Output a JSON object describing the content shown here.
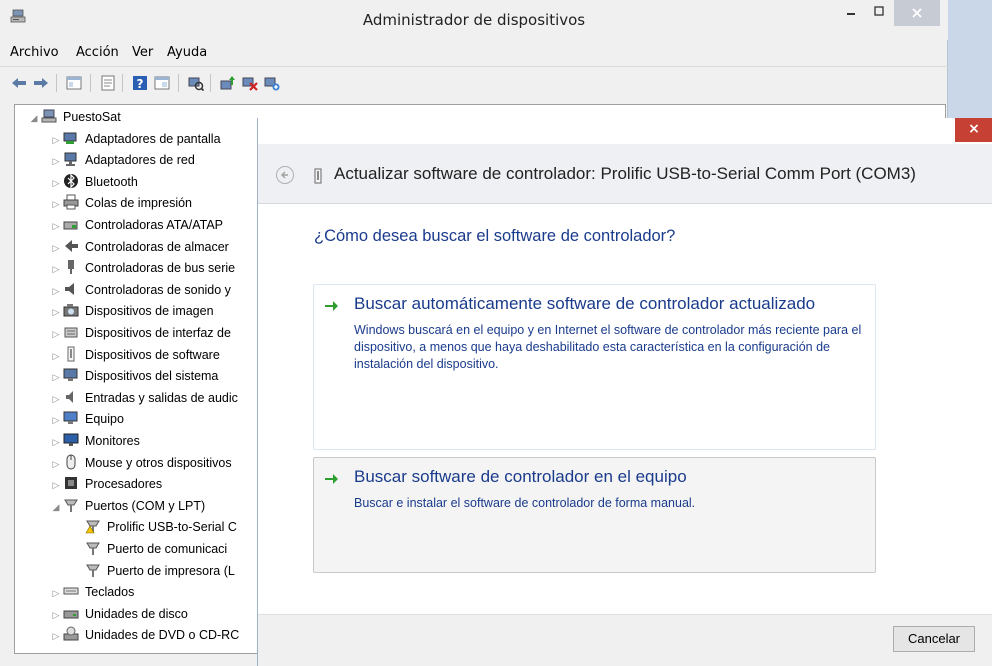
{
  "window": {
    "title": "Administrador de dispositivos"
  },
  "menu": [
    "Archivo",
    "Acción",
    "Ver",
    "Ayuda"
  ],
  "tree": {
    "root": "PuestoSat",
    "items": [
      {
        "label": "Adaptadores de pantalla",
        "icon": "display-adapter-icon"
      },
      {
        "label": "Adaptadores de red",
        "icon": "network-adapter-icon"
      },
      {
        "label": "Bluetooth",
        "icon": "bluetooth-icon"
      },
      {
        "label": "Colas de impresión",
        "icon": "printer-icon"
      },
      {
        "label": "Controladoras ATA/ATAP",
        "icon": "ata-controller-icon"
      },
      {
        "label": "Controladoras de almacer",
        "icon": "storage-controller-icon"
      },
      {
        "label": "Controladoras de bus serie",
        "icon": "usb-controller-icon"
      },
      {
        "label": "Controladoras de sonido y",
        "icon": "sound-icon"
      },
      {
        "label": "Dispositivos de imagen",
        "icon": "imaging-device-icon"
      },
      {
        "label": "Dispositivos de interfaz de",
        "icon": "hid-icon"
      },
      {
        "label": "Dispositivos de software",
        "icon": "software-device-icon"
      },
      {
        "label": "Dispositivos del sistema",
        "icon": "system-device-icon"
      },
      {
        "label": "Entradas y salidas de audic",
        "icon": "audio-io-icon"
      },
      {
        "label": "Equipo",
        "icon": "computer-icon"
      },
      {
        "label": "Monitores",
        "icon": "monitor-icon"
      },
      {
        "label": "Mouse y otros dispositivos",
        "icon": "mouse-icon"
      },
      {
        "label": "Procesadores",
        "icon": "processor-icon"
      },
      {
        "label": "Puertos (COM y LPT)",
        "icon": "port-icon"
      }
    ],
    "ports_children": [
      {
        "label": "Prolific USB-to-Serial C",
        "icon": "port-warning-icon"
      },
      {
        "label": "Puerto de comunicaci",
        "icon": "port-icon"
      },
      {
        "label": "Puerto de impresora (L",
        "icon": "port-icon"
      }
    ],
    "items_after": [
      {
        "label": "Teclados",
        "icon": "keyboard-icon"
      },
      {
        "label": "Unidades de disco",
        "icon": "disk-drive-icon"
      },
      {
        "label": "Unidades de DVD o CD-RC",
        "icon": "dvd-drive-icon"
      }
    ]
  },
  "dialog": {
    "close_label": "×",
    "header_title": "Actualizar software de controlador: Prolific USB-to-Serial Comm Port (COM3)",
    "question": "¿Cómo desea buscar el software de controlador?",
    "option1": {
      "title": "Buscar automáticamente software de controlador actualizado",
      "desc": "Windows buscará en el equipo y en Internet el software de controlador más reciente para el dispositivo, a menos que haya deshabilitado esta característica en la configuración de instalación del dispositivo."
    },
    "option2": {
      "title": "Buscar software de controlador en el equipo",
      "desc": "Buscar e instalar el software de controlador de forma manual."
    },
    "cancel_label": "Cancelar"
  },
  "colors": {
    "link_blue": "#1a3b8c",
    "arrow_green": "#2e9e2e",
    "close_red": "#c74034"
  }
}
